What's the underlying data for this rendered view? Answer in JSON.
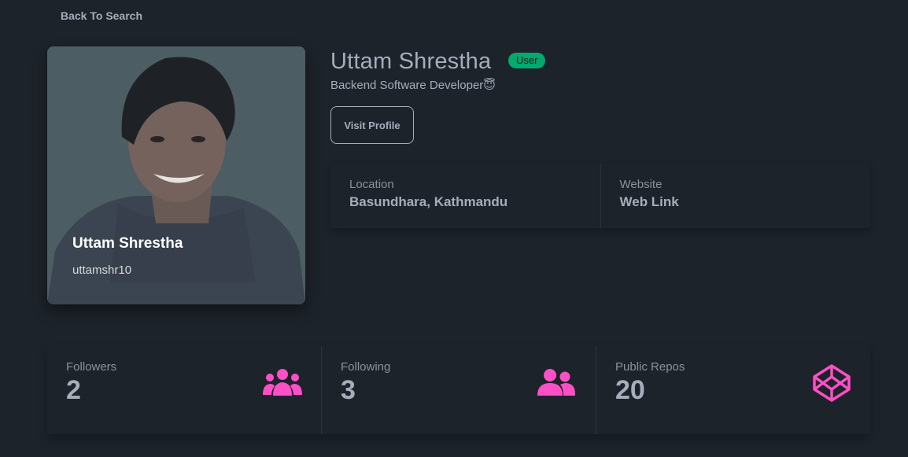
{
  "nav": {
    "back_label": "Back To Search"
  },
  "avatar": {
    "name": "Uttam Shrestha",
    "login": "uttamshr10"
  },
  "profile": {
    "name": "Uttam Shrestha",
    "type": "User",
    "bio": "Backend Software Developer😇",
    "visit_label": "Visit Profile"
  },
  "info": [
    {
      "title": "Location",
      "value": "Basundhara, Kathmandu"
    },
    {
      "title": "Website",
      "value": "Web Link"
    }
  ],
  "stats": [
    {
      "title": "Followers",
      "value": "2",
      "icon": "users-icon"
    },
    {
      "title": "Following",
      "value": "3",
      "icon": "user-friends-icon"
    },
    {
      "title": "Public Repos",
      "value": "20",
      "icon": "codepen-icon"
    }
  ],
  "colors": {
    "background": "#1d232a",
    "badge": "#00a96e",
    "icon_accent": "#ff4fc6"
  }
}
